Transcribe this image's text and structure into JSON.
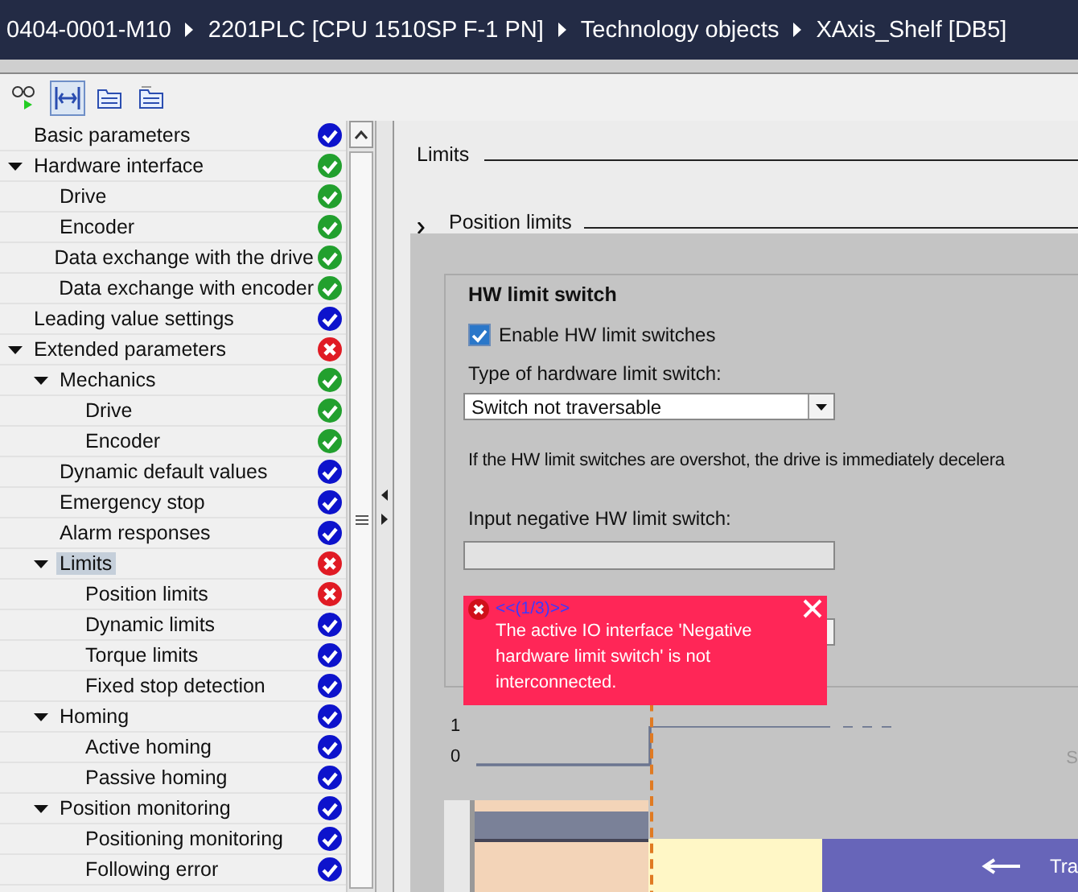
{
  "breadcrumb": [
    "0404-0001-M10",
    "2201PLC [CPU 1510SP F-1 PN]",
    "Technology objects",
    "XAxis_Shelf [DB5]"
  ],
  "toolbar": [
    {
      "kind": "glasses",
      "selected": false
    },
    {
      "kind": "split",
      "selected": true
    },
    {
      "kind": "folder",
      "selected": false
    },
    {
      "kind": "folders",
      "selected": false
    }
  ],
  "tree": [
    {
      "label": "Basic parameters",
      "kind": "done",
      "selected": false
    },
    {
      "label": "Hardware interface",
      "kind": "ok",
      "selected": false,
      "expanded": true,
      "children": [
        {
          "label": "Drive",
          "kind": "ok",
          "selected": false
        },
        {
          "label": "Encoder",
          "kind": "ok",
          "selected": false
        },
        {
          "label": "Data exchange with the drive",
          "kind": "ok",
          "selected": false
        },
        {
          "label": "Data exchange with encoder",
          "kind": "ok",
          "selected": false
        }
      ]
    },
    {
      "label": "Leading value settings",
      "kind": "done",
      "selected": false
    },
    {
      "label": "Extended parameters",
      "kind": "error",
      "selected": false,
      "expanded": true,
      "children": [
        {
          "label": "Mechanics",
          "kind": "ok",
          "selected": false,
          "expanded": true,
          "children": [
            {
              "label": "Drive",
              "kind": "ok",
              "selected": false
            },
            {
              "label": "Encoder",
              "kind": "ok",
              "selected": false
            }
          ]
        },
        {
          "label": "Dynamic default values",
          "kind": "done",
          "selected": false
        },
        {
          "label": "Emergency stop",
          "kind": "done",
          "selected": false
        },
        {
          "label": "Alarm responses",
          "kind": "done",
          "selected": false
        },
        {
          "label": "Limits",
          "kind": "error",
          "selected": true,
          "expanded": true,
          "children": [
            {
              "label": "Position limits",
              "kind": "error",
              "selected": false
            },
            {
              "label": "Dynamic limits",
              "kind": "done",
              "selected": false
            },
            {
              "label": "Torque limits",
              "kind": "done",
              "selected": false
            },
            {
              "label": "Fixed stop detection",
              "kind": "done",
              "selected": false
            }
          ]
        },
        {
          "label": "Homing",
          "kind": "done",
          "selected": false,
          "expanded": true,
          "children": [
            {
              "label": "Active homing",
              "kind": "done",
              "selected": false
            },
            {
              "label": "Passive homing",
              "kind": "done",
              "selected": false
            }
          ]
        },
        {
          "label": "Position monitoring",
          "kind": "done",
          "selected": false,
          "expanded": true,
          "children": [
            {
              "label": "Positioning monitoring",
              "kind": "done",
              "selected": false
            },
            {
              "label": "Following error",
              "kind": "done",
              "selected": false
            }
          ]
        }
      ]
    }
  ],
  "section_title": "Limits",
  "subsection": {
    "title": "Position limits",
    "expanded": false
  },
  "group": {
    "title": "HW limit switch",
    "enable_checkbox": {
      "label": "Enable HW limit switches",
      "checked": true
    },
    "type_label": "Type of hardware limit switch:",
    "type_value": "Switch not traversable",
    "note_text": "If the HW limit switches are overshot, the drive is immediately decelera",
    "negative_label": "Input negative HW limit switch:"
  },
  "error_popup": {
    "nav": "<<(1/3)>>",
    "message": "The active IO interface 'Negative hardware limit switch' is not interconnected."
  },
  "diagram": {
    "level_high": "1",
    "level_low": "0",
    "side_text": "S",
    "direction_text": "Tra"
  }
}
